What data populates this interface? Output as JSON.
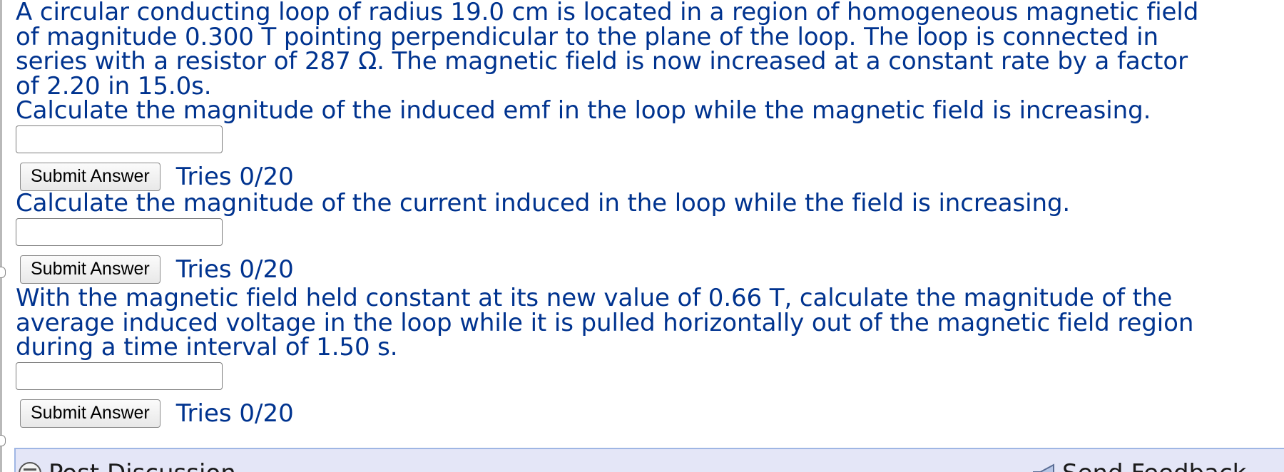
{
  "questions": [
    {
      "lines": [
        "A circular conducting loop of radius 19.0 cm is located in a region of homogeneous magnetic field",
        "of magnitude 0.300 T pointing perpendicular to the plane of the loop. The loop is connected in",
        "series with a resistor of 287 Ω. The magnetic field is now increased at a constant rate by a factor",
        "of 2.20 in 15.0s.",
        "Calculate the magnitude of the induced emf in the loop while the magnetic field is increasing."
      ],
      "input_value": "",
      "submit_label": "Submit Answer",
      "tries": "Tries 0/20"
    },
    {
      "lines": [
        "Calculate the magnitude of the current induced in the loop while the field is increasing."
      ],
      "input_value": "",
      "submit_label": "Submit Answer",
      "tries": "Tries 0/20"
    },
    {
      "lines": [
        "With the magnetic field held constant at its new value of 0.66 T, calculate the magnitude of the",
        "average induced voltage in the loop while it is pulled horizontally out of the magnetic field region",
        "during a time interval of 1.50 s."
      ],
      "input_value": "",
      "submit_label": "Submit Answer",
      "tries": "Tries 0/20"
    }
  ],
  "footer": {
    "post_discussion_label": "Post Discussion",
    "send_feedback_label": "Send Feedback",
    "icons": {
      "discussion": "discussion-icon",
      "feedback": "megaphone-icon"
    }
  },
  "colors": {
    "question_text": "#00338f",
    "footer_background": "#e4e6f7",
    "footer_border": "#9fb6e4"
  }
}
